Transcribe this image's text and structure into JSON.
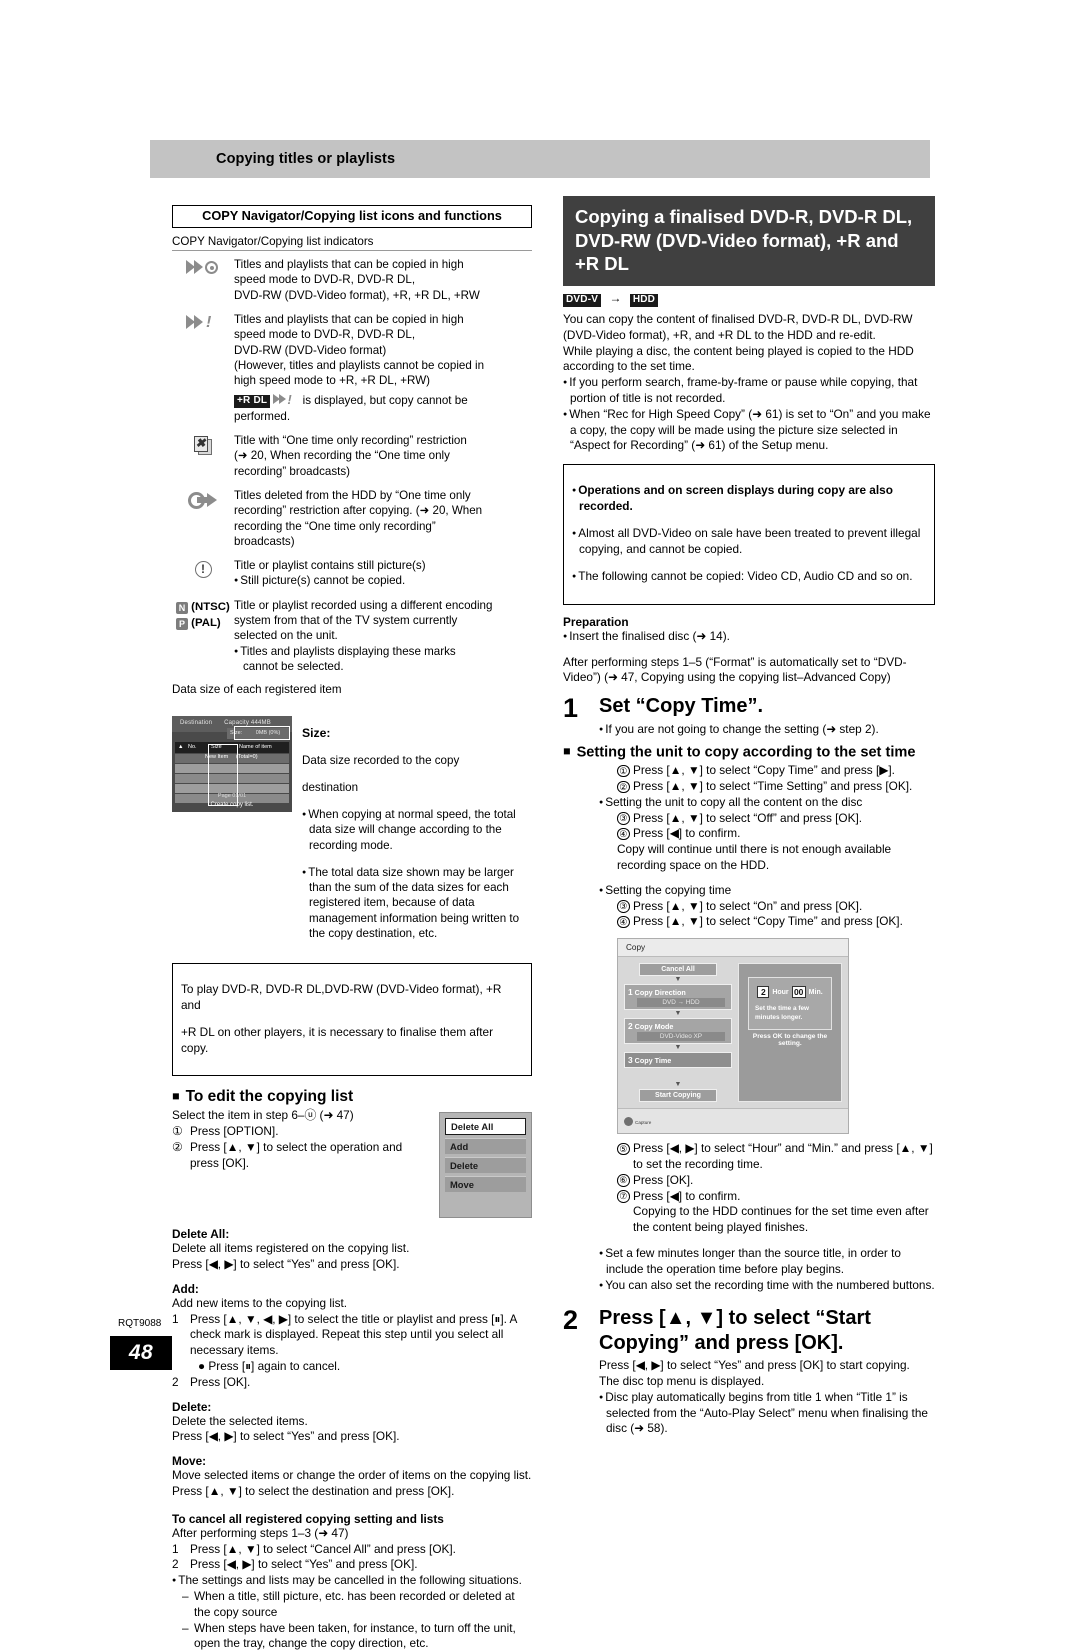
{
  "runhead": {
    "title": "Copying titles or playlists"
  },
  "left": {
    "box_title": "COPY Navigator/Copying list icons and functions",
    "indicators_caption": "COPY Navigator/Copying list indicators",
    "icons": [
      {
        "name": "high-speed-copy-disc-icon",
        "lines": [
          "Titles and playlists that can be copied in high",
          "speed mode to DVD-R, DVD-R DL,",
          "DVD-RW (DVD-Video format), +R, +R DL, +RW"
        ]
      },
      {
        "name": "high-speed-copy-exclaim-icon",
        "lines": [
          "Titles and playlists that can be copied in high",
          "speed mode to DVD-R, DVD-R DL,",
          "DVD-RW (DVD-Video format)",
          "(However, titles and playlists cannot be copied in",
          "high speed mode to +R, +R DL, +RW)"
        ],
        "badge_note_badge": "+R DL",
        "badge_note_text": "is displayed, but copy cannot be",
        "badge_note_text2": "performed."
      },
      {
        "name": "one-time-only-recording-icon",
        "lines": [
          "Title with “One time only recording” restriction",
          "(➜ 20, When recording the “One time only",
          "recording” broadcasts)"
        ]
      },
      {
        "name": "move-after-copy-icon",
        "lines": [
          "Titles deleted from the HDD by “One time only",
          "recording” restriction after copying. (➜ 20, When",
          "recording the “One time only recording”",
          "broadcasts)"
        ]
      },
      {
        "name": "still-picture-warning-icon",
        "lines": [
          "Title or playlist contains still picture(s)"
        ],
        "bullets": [
          "Still picture(s) cannot be copied."
        ]
      }
    ],
    "system_marks": {
      "ntsc": "(NTSC)",
      "pal": "(PAL)",
      "ntsc_glyph": "N",
      "pal_glyph": "P",
      "lines": [
        "Title or playlist recorded using a different encoding",
        "system from that of the TV system currently",
        "selected on the unit."
      ],
      "bullets": [
        "Titles and playlists displaying these marks",
        "cannot be selected."
      ]
    },
    "datasize": {
      "caption": "Data size of each registered item",
      "screen": {
        "header_left": "Destination",
        "header_right": "Capacity 444MB",
        "size_label": "Size:",
        "size_value": "0MB (0%)",
        "col_arrow": "▲",
        "col_no": "No.",
        "col_size": "Size",
        "col_name": "Name of item",
        "row_new": "New Item",
        "row_total": "(Total=0)",
        "page": "Page 01/01",
        "hint": "Create copy list."
      },
      "title": "Size:",
      "lines": [
        "Data size recorded to the copy",
        "destination"
      ],
      "bullets": [
        "When copying at normal speed, the total data size will change according to the recording mode.",
        "The total data size shown may be larger than the sum of the data sizes for each registered item, because of data management information being written to the copy destination, etc."
      ]
    },
    "notebox": [
      "To play DVD-R, DVD-R DL,DVD-RW (DVD-Video format), +R and",
      "+R DL on other players, it is necessary to finalise them after copy."
    ],
    "edit_heading": "To edit the copying list",
    "edit_intro": "Select the item in step 6–ⓤ (➜ 47)",
    "edit_steps": [
      {
        "n": "①",
        "t": "Press [OPTION]."
      },
      {
        "n": "②",
        "t": "Press [▲, ▼] to select the operation and press [OK]."
      }
    ],
    "option_menu": [
      "Delete All",
      "Add",
      "Delete",
      "Move"
    ],
    "sections": [
      {
        "title": "Delete All:",
        "lines": [
          "Delete all items registered on the copying list.",
          "Press [◀, ▶] to select “Yes” and press [OK]."
        ]
      },
      {
        "title": "Add:",
        "lines": [
          "Add new items to the copying list."
        ],
        "numbered": [
          {
            "n": "1",
            "t": "Press [▲, ▼, ◀, ▶] to select the title or playlist and press [⏸]. A check mark is displayed. Repeat this step until you select all necessary items."
          },
          {
            "n": "",
            "t": "● Press [⏸] again to cancel.",
            "bullet": true
          },
          {
            "n": "2",
            "t": "Press [OK]."
          }
        ]
      },
      {
        "title": "Delete:",
        "lines": [
          "Delete the selected items.",
          "Press [◀, ▶] to select “Yes” and press [OK]."
        ]
      },
      {
        "title": "Move:",
        "lines": [
          "Move selected items or change the order of items on the copying list.",
          "Press [▲, ▼] to select the destination and press [OK]."
        ]
      }
    ],
    "cancel_title": "To cancel all registered copying setting and lists",
    "cancel_intro": "After performing steps 1–3 (➜ 47)",
    "cancel_steps": [
      {
        "n": "1",
        "t": "Press [▲, ▼] to select “Cancel All” and press [OK]."
      },
      {
        "n": "2",
        "t": "Press [◀, ▶] to select “Yes” and press [OK]."
      }
    ],
    "cancel_bullet": "The settings and lists may be cancelled in the following situations.",
    "cancel_dashes": [
      "When a title, still picture, etc. has been recorded or deleted at the copy source",
      "When steps have been taken, for instance, to turn off the unit, open the tray, change the copy direction, etc."
    ]
  },
  "right": {
    "section_title": "Copying a finalised DVD-R, DVD-R DL, DVD-RW (DVD-Video format), +R and +R DL",
    "badge_from": "DVD-V",
    "badge_arrow": "→",
    "badge_to": "HDD",
    "intro": [
      "You can copy the content of finalised DVD-R, DVD-R DL, DVD-RW",
      "(DVD-Video format), +R, and +R DL to the HDD and re-edit.",
      "While playing a disc, the content being played is copied to the HDD",
      "according to the set time."
    ],
    "intro_bullets": [
      "If you perform search, frame-by-frame or pause while copying, that portion of title is not recorded.",
      "When “Rec for High Speed Copy” (➜ 61) is set to “On” and you make a copy, the copy will be made using the picture size selected in “Aspect for Recording” (➜ 61) of the Setup menu."
    ],
    "notebox_bullets": [
      {
        "text": "Operations and on screen displays during copy are also recorded.",
        "bold": true
      },
      {
        "text": "Almost all DVD-Video on sale have been treated to prevent illegal copying, and cannot be copied.",
        "bold": false
      },
      {
        "text": "The following cannot be copied: Video CD, Audio CD and so on.",
        "bold": false
      }
    ],
    "prep_title": "Preparation",
    "prep_bullet": "Insert the finalised disc (➜ 14).",
    "after_steps": [
      "After performing steps 1–5 (“Format” is automatically set to “DVD-",
      "Video”) (➜ 47, Copying using the copying list–Advanced Copy)"
    ],
    "step1_num": "1",
    "step1_title": "Set “Copy Time”.",
    "step1_bullet": "If you are not going to change the setting (➜ step 2).",
    "step1_sub_heading": "Setting the unit to copy according to the set time",
    "step1_items": [
      {
        "n": "①",
        "t": "Press [▲, ▼] to select “Copy Time” and press [▶]."
      },
      {
        "n": "②",
        "t": "Press [▲, ▼] to select “Time Setting” and press [OK]."
      }
    ],
    "step1_bullet_all": "Setting the unit to copy all the content on the disc",
    "step1_items_all": [
      {
        "n": "③",
        "t": "Press [▲, ▼] to select “Off” and press [OK]."
      },
      {
        "n": "④",
        "t": "Press [◀] to confirm."
      }
    ],
    "step1_all_note": [
      "Copy will continue until there is not enough available",
      "recording space on the HDD."
    ],
    "step1_bullet_time": "Setting the copying time",
    "step1_items_time": [
      {
        "n": "③",
        "t": "Press [▲, ▼] to select “On” and press [OK]."
      },
      {
        "n": "④",
        "t": "Press [▲, ▼] to select “Copy Time” and press [OK]."
      }
    ],
    "copy_screen": {
      "title": "Copy",
      "cancel_all": "Cancel All",
      "items": [
        {
          "no": "1",
          "label": "Copy Direction",
          "value": "DVD → HDD"
        },
        {
          "no": "2",
          "label": "Copy Mode",
          "value": "DVD-Video   XP"
        },
        {
          "no": "3",
          "label": "Copy Time",
          "value": ""
        }
      ],
      "start": "Start Copying",
      "hour_value": "2",
      "hour_label": "Hour",
      "min_value": "00",
      "min_label": "Min.",
      "note": "Set the time a few minutes longer.",
      "footer": "Press OK to change the setting.",
      "status": "Capture"
    },
    "step1_items_after": [
      {
        "n": "⑤",
        "t": "Press [◀, ▶] to select “Hour” and “Min.” and press [▲, ▼] to set the recording time."
      },
      {
        "n": "⑥",
        "t": "Press [OK]."
      },
      {
        "n": "⑦",
        "t": "Press [◀] to confirm."
      }
    ],
    "step1_after_note": [
      "Copying to the HDD continues for the set time even after",
      "the content being played finishes."
    ],
    "step1_final_bullets": [
      "Set a few minutes longer than the source title, in order to include the operation time before play begins.",
      "You can also set the recording time with the numbered buttons."
    ],
    "step2_num": "2",
    "step2_title": "Press [▲, ▼] to select “Start Copying” and press [OK].",
    "step2_body": [
      "Press [◀, ▶] to select “Yes” and press [OK] to start copying.",
      "The disc top menu is displayed."
    ],
    "step2_bullet": "Disc play automatically begins from title 1 when “Title 1” is selected from the “Auto-Play Select” menu when finalising the disc (➜ 58)."
  },
  "footer": {
    "code": "RQT9088",
    "page_number": "48"
  }
}
